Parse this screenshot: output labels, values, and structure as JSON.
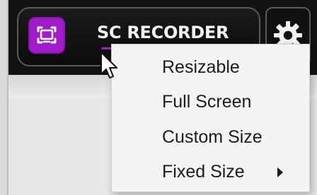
{
  "app": {
    "title": "SC RECORDER",
    "accent_color": "#a21bc9"
  },
  "icons": {
    "app_icon": "screen-capture-icon",
    "settings_icon": "gear-icon",
    "cursor": "mouse-pointer-icon",
    "submenu": "submenu-arrow-icon"
  },
  "menu": {
    "items": [
      {
        "label": "Resizable"
      },
      {
        "label": "Full Screen"
      },
      {
        "label": "Custom Size"
      },
      {
        "label": "Fixed Size"
      }
    ]
  }
}
